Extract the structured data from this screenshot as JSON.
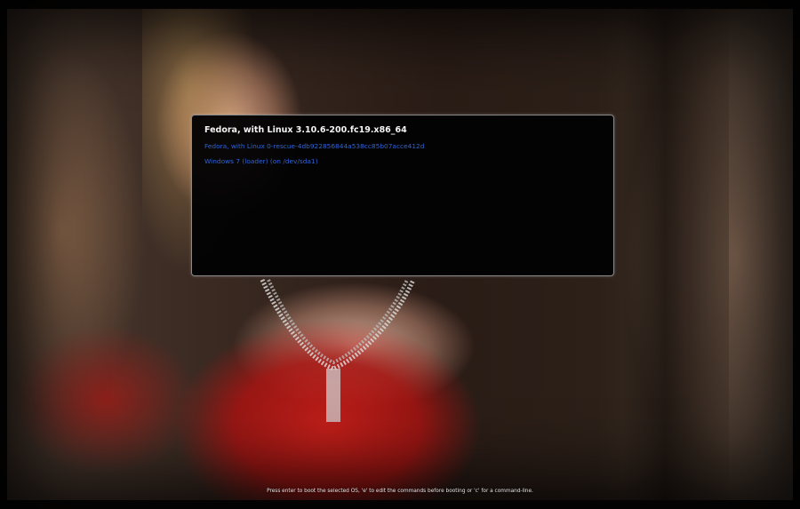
{
  "boot_menu": {
    "entries": [
      {
        "label": "Fedora, with Linux 3.10.6-200.fc19.x86_64",
        "selected": true
      },
      {
        "label": "Fedora, with Linux 0-rescue-4db922856844a538cc85b07acce412d",
        "selected": false
      },
      {
        "label": "Windows 7 (loader) (on /dev/sda1)",
        "selected": false
      }
    ]
  },
  "footer": {
    "hint": "Press enter to boot the selected OS, 'e' to edit the commands before booting or 'c' for a command-line."
  },
  "colors": {
    "selected_text": "#f4f4f4",
    "normal_text": "#2f64d6",
    "menu_background": "#020203",
    "menu_border": "#8a8a8a"
  }
}
